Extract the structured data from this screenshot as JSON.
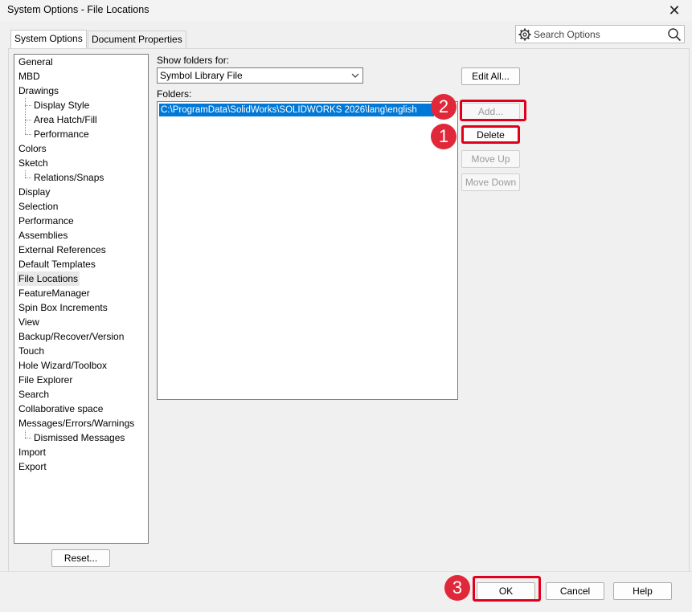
{
  "window": {
    "title": "System Options - File Locations",
    "close_glyph": "✕"
  },
  "tabs": [
    {
      "label": "System Options",
      "active": true
    },
    {
      "label": "Document Properties",
      "active": false
    }
  ],
  "search": {
    "placeholder": "Search Options",
    "icon": "gear-icon",
    "button_icon": "magnifier-icon"
  },
  "tree": {
    "items": [
      {
        "label": "General",
        "level": 0
      },
      {
        "label": "MBD",
        "level": 0
      },
      {
        "label": "Drawings",
        "level": 0
      },
      {
        "label": "Display Style",
        "level": 1
      },
      {
        "label": "Area Hatch/Fill",
        "level": 1
      },
      {
        "label": "Performance",
        "level": 1
      },
      {
        "label": "Colors",
        "level": 0
      },
      {
        "label": "Sketch",
        "level": 0
      },
      {
        "label": "Relations/Snaps",
        "level": 1
      },
      {
        "label": "Display",
        "level": 0
      },
      {
        "label": "Selection",
        "level": 0
      },
      {
        "label": "Performance",
        "level": 0
      },
      {
        "label": "Assemblies",
        "level": 0
      },
      {
        "label": "External References",
        "level": 0
      },
      {
        "label": "Default Templates",
        "level": 0
      },
      {
        "label": "File Locations",
        "level": 0,
        "selected": true
      },
      {
        "label": "FeatureManager",
        "level": 0
      },
      {
        "label": "Spin Box Increments",
        "level": 0
      },
      {
        "label": "View",
        "level": 0
      },
      {
        "label": "Backup/Recover/Version",
        "level": 0
      },
      {
        "label": "Touch",
        "level": 0
      },
      {
        "label": "Hole Wizard/Toolbox",
        "level": 0
      },
      {
        "label": "File Explorer",
        "level": 0
      },
      {
        "label": "Search",
        "level": 0
      },
      {
        "label": "Collaborative space",
        "level": 0
      },
      {
        "label": "Messages/Errors/Warnings",
        "level": 0
      },
      {
        "label": "Dismissed Messages",
        "level": 1
      },
      {
        "label": "Import",
        "level": 0
      },
      {
        "label": "Export",
        "level": 0
      }
    ],
    "reset_label": "Reset..."
  },
  "main": {
    "show_folders_label": "Show folders for:",
    "show_folders_value": "Symbol Library File",
    "folders_label": "Folders:",
    "folders": [
      "C:\\ProgramData\\SolidWorks\\SOLIDWORKS 2026\\lang\\english"
    ],
    "buttons": {
      "edit_all": "Edit All...",
      "add": "Add...",
      "delete": "Delete",
      "move_up": "Move Up",
      "move_down": "Move Down"
    }
  },
  "footer": {
    "ok": "OK",
    "cancel": "Cancel",
    "help": "Help"
  },
  "annotations": {
    "badge_1": "1",
    "badge_2": "2",
    "badge_3": "3",
    "highlight_color": "#e0001b",
    "badge_color": "#e0283a"
  },
  "colors": {
    "selection": "#0078d7"
  }
}
